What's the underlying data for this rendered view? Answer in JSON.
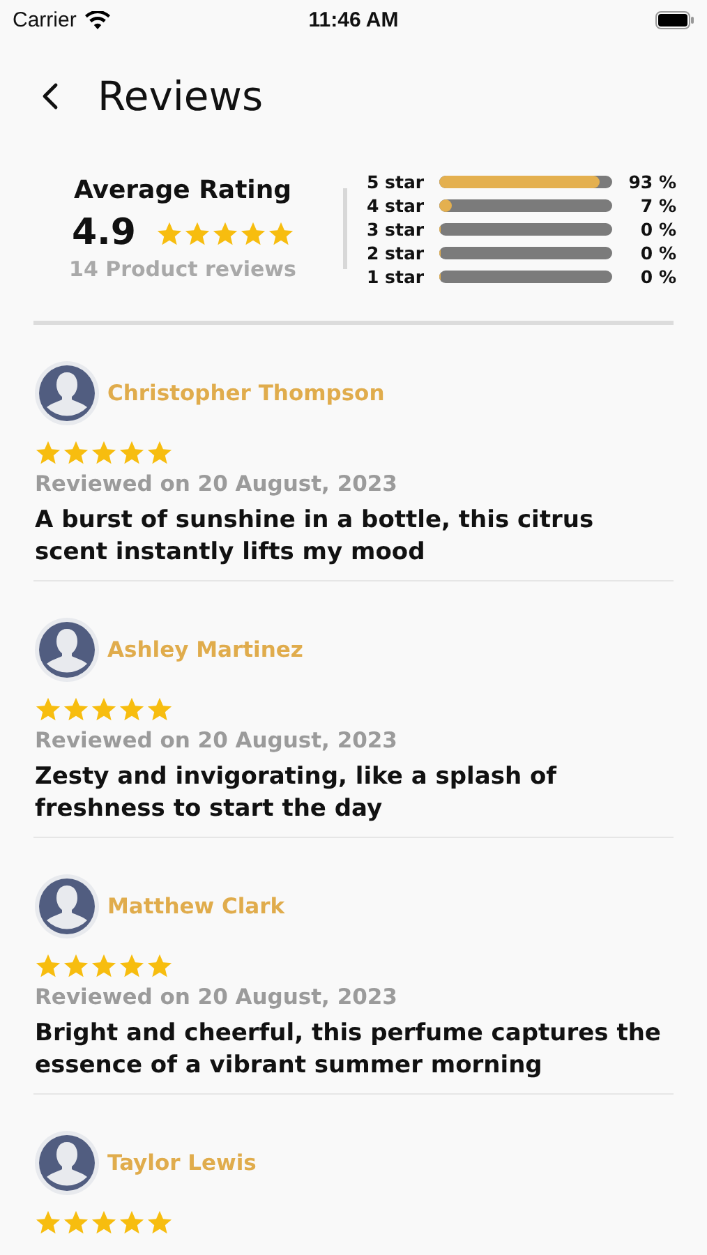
{
  "status_bar": {
    "carrier": "Carrier",
    "time": "11:46 AM"
  },
  "header": {
    "title": "Reviews"
  },
  "summary": {
    "heading": "Average Rating",
    "average": "4.9",
    "stars": 5,
    "count": "14 Product reviews",
    "breakdown": [
      {
        "label": "5 star",
        "level": 0.93,
        "reading": "93 %"
      },
      {
        "label": "4 star",
        "level": 0.07,
        "reading": "7 %"
      },
      {
        "label": "3 star",
        "level": 0,
        "reading": "0 %"
      },
      {
        "label": "2 star",
        "level": 0,
        "reading": "0 %"
      },
      {
        "label": "1 star",
        "level": 0,
        "reading": "0 %"
      }
    ]
  },
  "reviews": [
    {
      "name": "Christopher Thompson",
      "stars": 5,
      "date": "Reviewed on 20 August, 2023",
      "text": "A burst of sunshine in a bottle, this citrus scent instantly lifts my mood"
    },
    {
      "name": "Ashley Martinez",
      "stars": 5,
      "date": "Reviewed on 20 August, 2023",
      "text": "Zesty and invigorating, like a splash of freshness to start the day"
    },
    {
      "name": "Matthew Clark",
      "stars": 5,
      "date": "Reviewed on 20 August, 2023",
      "text": "Bright and cheerful, this perfume captures the essence of a vibrant summer morning"
    },
    {
      "name": "Taylor Lewis",
      "stars": 5
    }
  ]
}
